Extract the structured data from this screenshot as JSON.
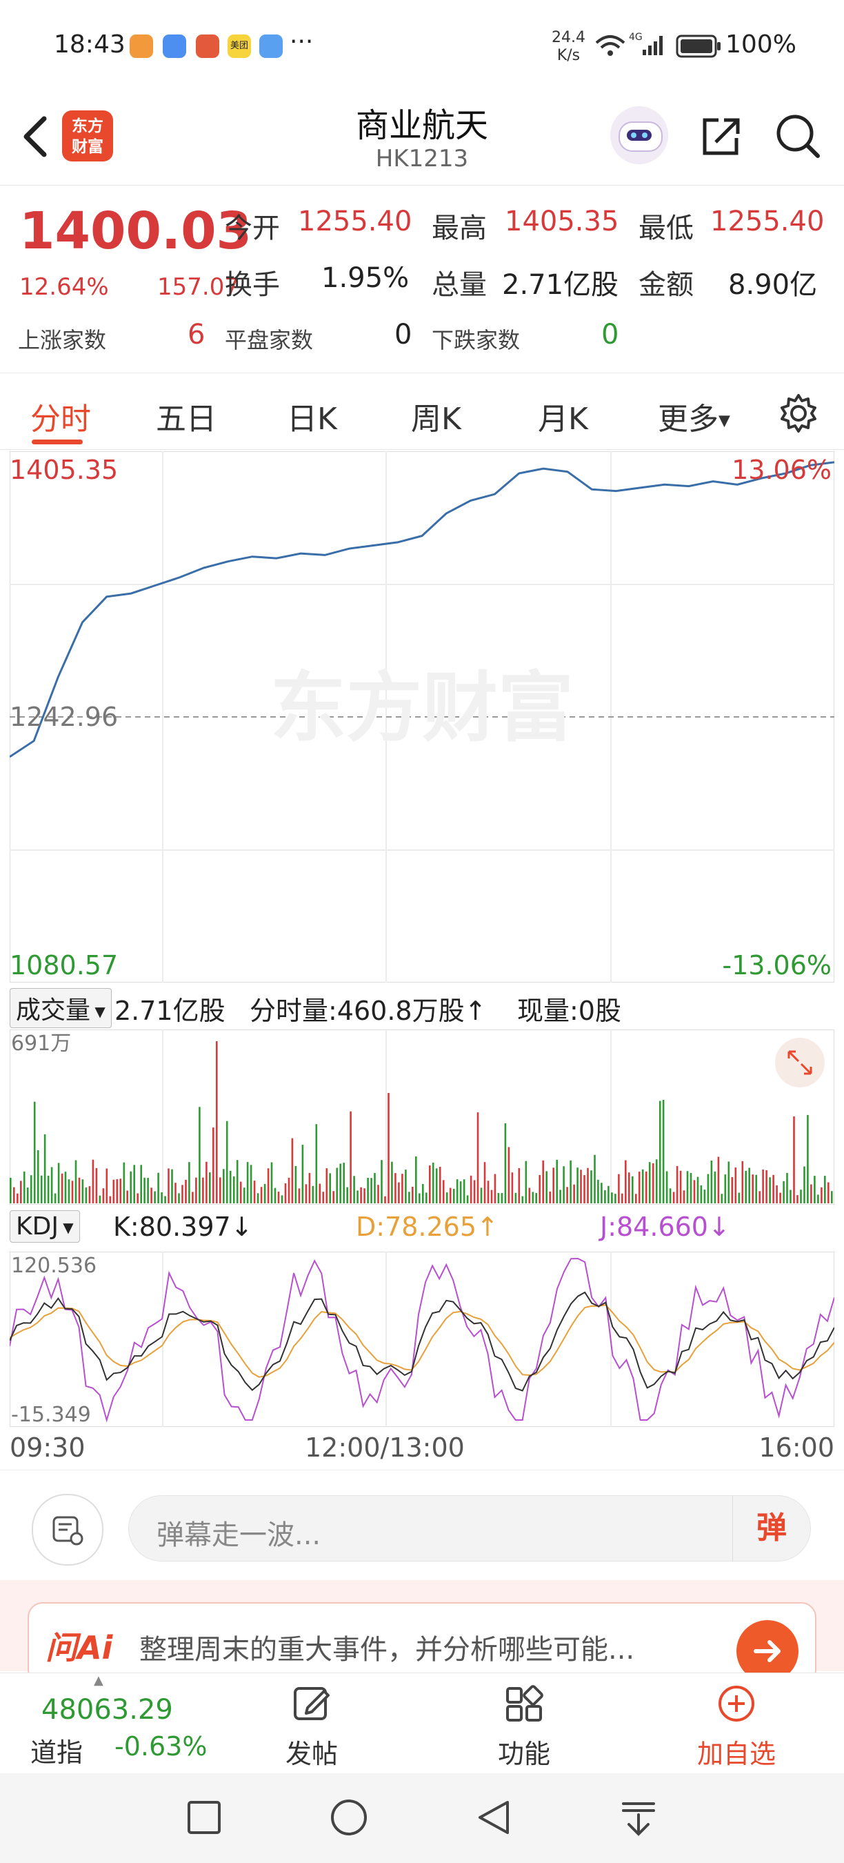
{
  "status_bar": {
    "time": "18:43",
    "net_speed_value": "24.4",
    "net_speed_unit": "K/s",
    "network": "4G",
    "battery": "100%"
  },
  "header": {
    "logo_line1": "东方",
    "logo_line2": "财富",
    "title": "商业航天",
    "subtitle": "HK1213"
  },
  "quote": {
    "price": "1400.03",
    "change_pct": "12.64%",
    "change_value": "157.07",
    "open_label": "今开",
    "open_value": "1255.40",
    "high_label": "最高",
    "high_value": "1405.35",
    "low_label": "最低",
    "low_value": "1255.40",
    "turnover_label": "换手",
    "turnover_value": "1.95%",
    "volume_label": "总量",
    "volume_value": "2.71亿股",
    "amount_label": "金额",
    "amount_value": "8.90亿",
    "up_label": "上涨家数",
    "up_value": "6",
    "flat_label": "平盘家数",
    "flat_value": "0",
    "down_label": "下跌家数",
    "down_value": "0"
  },
  "tabs": [
    "分时",
    "五日",
    "日K",
    "周K",
    "月K",
    "更多"
  ],
  "price_chart": {
    "high_label": "1405.35",
    "high_pct": "13.06%",
    "ref_label": "1242.96",
    "low_label": "1080.57",
    "low_pct": "-13.06%",
    "watermark": "东方财富"
  },
  "volume_section": {
    "selector": "成交量",
    "total": "2.71亿股",
    "minute_volume": "分时量:460.8万股↑",
    "current_volume": "现量:0股",
    "max_label": "691万"
  },
  "kdj_section": {
    "selector": "KDJ",
    "k": "K:80.397↓",
    "d": "D:78.265↑",
    "j": "J:84.660↓",
    "max_label": "120.536",
    "min_label": "-15.349"
  },
  "time_axis": {
    "start": "09:30",
    "mid": "12:00/13:00",
    "end": "16:00"
  },
  "danmu": {
    "placeholder": "弹幕走一波...",
    "send": "弹"
  },
  "ai_banner": {
    "logo": "问Ai",
    "text": "整理周末的重大事件，并分析哪些可能..."
  },
  "bottom_bar": {
    "index_value": "48063.29",
    "index_name": "道指",
    "index_change": "-0.63%",
    "post": "发帖",
    "functions": "功能",
    "add_watch": "加自选"
  },
  "colors": {
    "up": "#d63a3a",
    "down": "#2f9a33",
    "brand": "#e8492d",
    "price_line": "#3a6ea8",
    "k_line": "#333333",
    "d_line": "#e8a03a",
    "j_line": "#b84fd0"
  },
  "chart_data": {
    "type": "line",
    "x_range": [
      "09:30",
      "16:00"
    ],
    "ylim": [
      1080.57,
      1405.35
    ],
    "reference": 1242.96,
    "series": [
      {
        "values": [
          1218,
          1228,
          1268,
          1302,
          1318,
          1320,
          1325,
          1330,
          1336,
          1340,
          1343,
          1342,
          1345,
          1344,
          1348,
          1350,
          1352,
          1356,
          1370,
          1378,
          1382,
          1395,
          1398,
          1396,
          1385,
          1384,
          1386,
          1388,
          1387,
          1390,
          1388,
          1392,
          1395,
          1400,
          1402
        ]
      }
    ]
  }
}
